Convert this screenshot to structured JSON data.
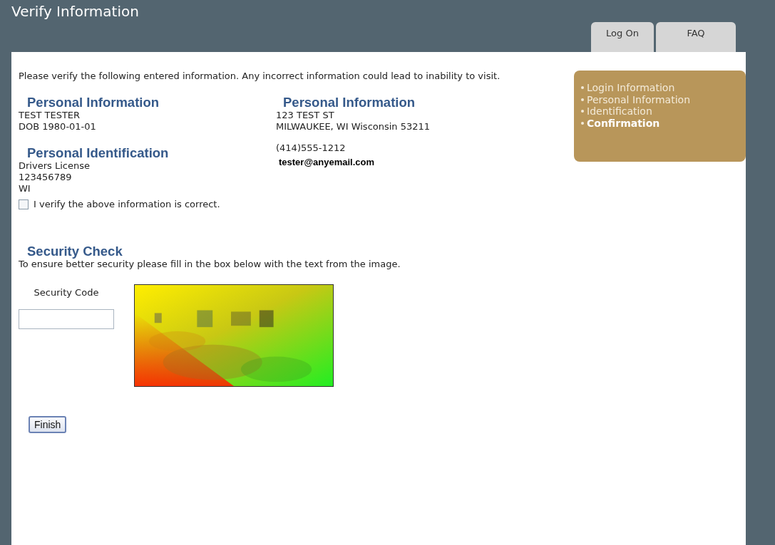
{
  "header": {
    "title": "Verify Information"
  },
  "tabs": [
    {
      "label": "Log On",
      "selected": false
    },
    {
      "label": "FAQ",
      "selected": false
    }
  ],
  "intro": "Please verify the following entered information. Any incorrect information could lead to inability to visit.",
  "personal": {
    "heading": "Personal Information",
    "lines": [
      "TEST TESTER",
      "DOB 1980-01-01"
    ]
  },
  "identification": {
    "heading": "Personal Identification",
    "lines": [
      "Drivers License",
      "123456789",
      "WI"
    ]
  },
  "address": {
    "heading": "Personal Information",
    "lines": [
      "123 TEST ST",
      "MILWAUKEE, WI Wisconsin 53211"
    ]
  },
  "contact": {
    "phone": "(414)555-1212",
    "email": "tester@anyemail.com"
  },
  "verify": {
    "label": "I verify the above information is correct.",
    "checked": false
  },
  "security": {
    "heading": "Security Check",
    "instructions": "To ensure better security please fill in the box below with the text from the image.",
    "code_label": "Security Code"
  },
  "finish_button": "Finish",
  "steps": [
    {
      "label": "Login Information",
      "selected": false
    },
    {
      "label": "Personal Information",
      "selected": false
    },
    {
      "label": "Identification",
      "selected": false
    },
    {
      "label": "Confirmation",
      "selected": true
    }
  ]
}
